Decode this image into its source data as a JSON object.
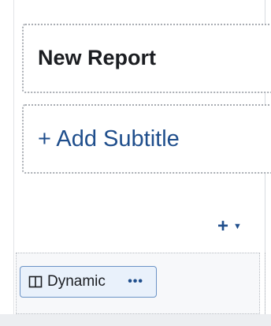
{
  "report": {
    "title": "New Report",
    "subtitle_placeholder": "+ Add Subtitle"
  },
  "toolbar": {
    "add_icon": "plus-icon",
    "add_label": "+",
    "dropdown_icon": "caret-down-icon",
    "dropdown_label": "▼"
  },
  "chip": {
    "icon": "columns-icon",
    "label": "Dynamic",
    "more_icon": "more-horizontal-icon",
    "more_label": "•••"
  },
  "colors": {
    "accent": "#1f4e8c",
    "chip_bg": "#e9f1fb",
    "chip_border": "#6b93c6",
    "dotted_border": "#a9adb3"
  }
}
